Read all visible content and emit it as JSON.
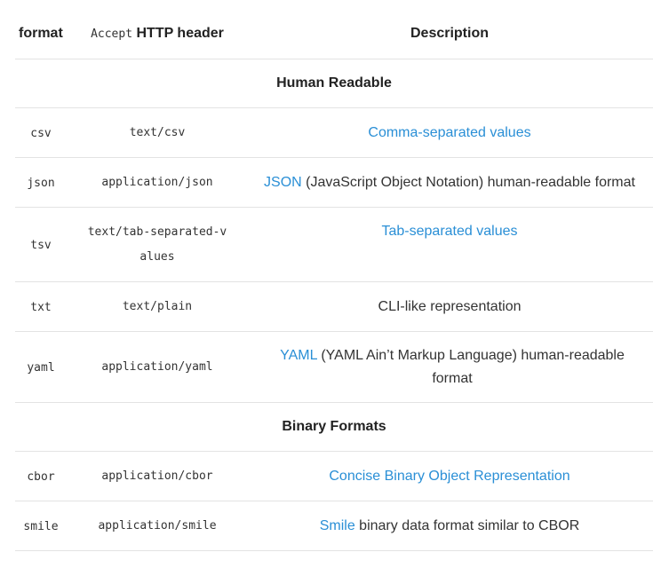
{
  "header": {
    "format": "format",
    "accept_code": "Accept",
    "accept_rest": "HTTP header",
    "description": "Description"
  },
  "sections": [
    {
      "title": "Human Readable",
      "rows": [
        {
          "format": "csv",
          "accept": "text/csv",
          "link": "Comma-separated values",
          "rest": ""
        },
        {
          "format": "json",
          "accept": "application/json",
          "link": "JSON",
          "rest": " (JavaScript Object Notation) human-readable format"
        },
        {
          "format": "tsv",
          "accept": "text/tab-separated-values",
          "link": "Tab-separated values",
          "rest": ""
        },
        {
          "format": "txt",
          "accept": "text/plain",
          "link": "",
          "rest": "CLI-like representation"
        },
        {
          "format": "yaml",
          "accept": "application/yaml",
          "link": "YAML",
          "rest": " (YAML Ain’t Markup Language) human-readable format"
        }
      ]
    },
    {
      "title": "Binary Formats",
      "rows": [
        {
          "format": "cbor",
          "accept": "application/cbor",
          "link": "Concise Binary Object Representation",
          "rest": ""
        },
        {
          "format": "smile",
          "accept": "application/smile",
          "link": "Smile",
          "rest": " binary data format similar to CBOR"
        }
      ]
    }
  ]
}
